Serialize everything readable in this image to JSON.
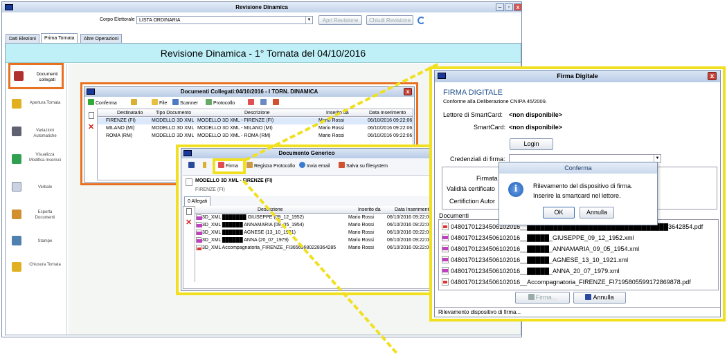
{
  "main_window": {
    "title": "Revisione Dinamica",
    "corpo_label": "Corpo Elettorale",
    "corpo_value": "LISTA ORDINARIA",
    "btn_apri": "Apri Revisione",
    "btn_chiudi": "Chiudi Revisione",
    "tabs": [
      "Dati Elezioni",
      "Prima Tornata",
      "Altre Operazioni"
    ],
    "banner": "Revisione Dinamica - 1° Tornata del 04/10/2016",
    "sidebar": [
      {
        "label": "Documenti collegati",
        "icon": "documents-icon",
        "color": "#b03030"
      },
      {
        "label": "Apertura Tornata",
        "icon": "open-lock-icon",
        "color": "#e0b020"
      },
      {
        "label": "Variazioni Automatiche",
        "icon": "tools-icon",
        "color": "#606070"
      },
      {
        "label": "Visualizza Modifica Inserisci",
        "icon": "edit-icon",
        "color": "#30a050"
      },
      {
        "label": "Verbale",
        "icon": "page-icon",
        "color": "#c8d4e4"
      },
      {
        "label": "Esporta Documenti",
        "icon": "export-icon",
        "color": "#d09030"
      },
      {
        "label": "Stampe",
        "icon": "printer-icon",
        "color": "#5080b0"
      },
      {
        "label": "Chiusura Tornata",
        "icon": "lock-icon",
        "color": "#e0b020"
      }
    ]
  },
  "docs_window": {
    "title": "Documenti Collegati:04/10/2016 - I TORN. DINAMICA",
    "toolbar": [
      "Conferma",
      "File",
      "Scanner",
      "Protocollo"
    ],
    "headers": [
      "Destinatario",
      "Tipo Documento",
      "Descrizione",
      "Inserito da",
      "Data Inserimento"
    ],
    "rows": [
      [
        "FIRENZE (FI)",
        "MODELLO 3D XML",
        "MODELLO 3D XML - FIRENZE (FI)",
        "Mario Rossi",
        "06/10/2016 09:22:06"
      ],
      [
        "MILANO (MI)",
        "MODELLO 3D XML",
        "MODELLO 3D XML - MILANO (MI)",
        "Mario Rossi",
        "06/10/2016 09:22:06"
      ],
      [
        "ROMA (RM)",
        "MODELLO 3D XML",
        "MODELLO 3D XML - ROMA (RM)",
        "Mario Rossi",
        "06/10/2016 09:22:06"
      ]
    ]
  },
  "generic_window": {
    "title": "Documento Generico",
    "toolbar": [
      "Firma",
      "Registra Protocollo",
      "Invia email",
      "Salva su filesystem"
    ],
    "doc_title": "MODELLO 3D XML - FIRENZE (FI)",
    "doc_sub": "FIRENZE (FI)",
    "tab": "Allegati",
    "headers": [
      "Descrizione",
      "Inserito da",
      "Data Inserimento"
    ],
    "rows": [
      [
        "3D_XML ███████ GIUSEPPE (09_12_1952)",
        "Mario Rossi",
        "06/10/2016 09:22:06"
      ],
      [
        "3D_XML ██████ ANNAMARIA (09_05_1954)",
        "Mario Rossi",
        "06/10/2016 09:22:06"
      ],
      [
        "3D_XML ██████ AGNESE (13_10_1921)",
        "Mario Rossi",
        "06/10/2016 09:22:06"
      ],
      [
        "3D_XML ██████ ANNA (20_07_1979)",
        "Mario Rossi",
        "06/10/2016 09:22:06"
      ],
      [
        "3D_XML  Accompagnatoria_FIRENZE_FI36565680228364285",
        "Mario Rossi",
        "06/10/2016 09:22:06"
      ]
    ]
  },
  "firma_window": {
    "title": "Firma Digitale",
    "heading": "FIRMA DIGITALE",
    "subheading": "Conforme alla Deliberazione CNIPA 45/2009.",
    "lettore_label": "Lettore di SmartCard:",
    "lettore_value": "<non disponibile>",
    "smartcard_label": "SmartCard:",
    "smartcard_value": "<non disponibile>",
    "login": "Login",
    "credenziali_label": "Credenziali di firma:",
    "firmata_label": "Firmata",
    "validita_label": "Validità certificato",
    "cert_label": "Certifiction Autor",
    "documenti_label": "Documenti",
    "files": [
      {
        "name": "04801701234506102016__████████████████████████████████3642854.pdf",
        "type": "pdf"
      },
      {
        "name": "04801701234506102016__█████_GIUSEPPE_09_12_1952.xml",
        "type": "xml"
      },
      {
        "name": "04801701234506102016__█████_ANNAMARIA_09_05_1954.xml",
        "type": "xml"
      },
      {
        "name": "04801701234506102016__█████_AGNESE_13_10_1921.xml",
        "type": "xml"
      },
      {
        "name": "04801701234506102016__█████_ANNA_20_07_1979.xml",
        "type": "xml"
      },
      {
        "name": "04801701234506102016__Accompagnatoria_FIRENZE_FI7195805599172869878.pdf",
        "type": "pdf"
      }
    ],
    "btn_firma": "Firma...",
    "btn_annulla": "Annulla",
    "status": "Rilevamento dispositivo di firma..."
  },
  "confirm_dialog": {
    "title": "Conferma",
    "message1": "Rilevamento del dispositivo di firma.",
    "message2": "Inserire la smartcard nel lettore.",
    "ok": "OK",
    "annulla": "Annulla"
  }
}
